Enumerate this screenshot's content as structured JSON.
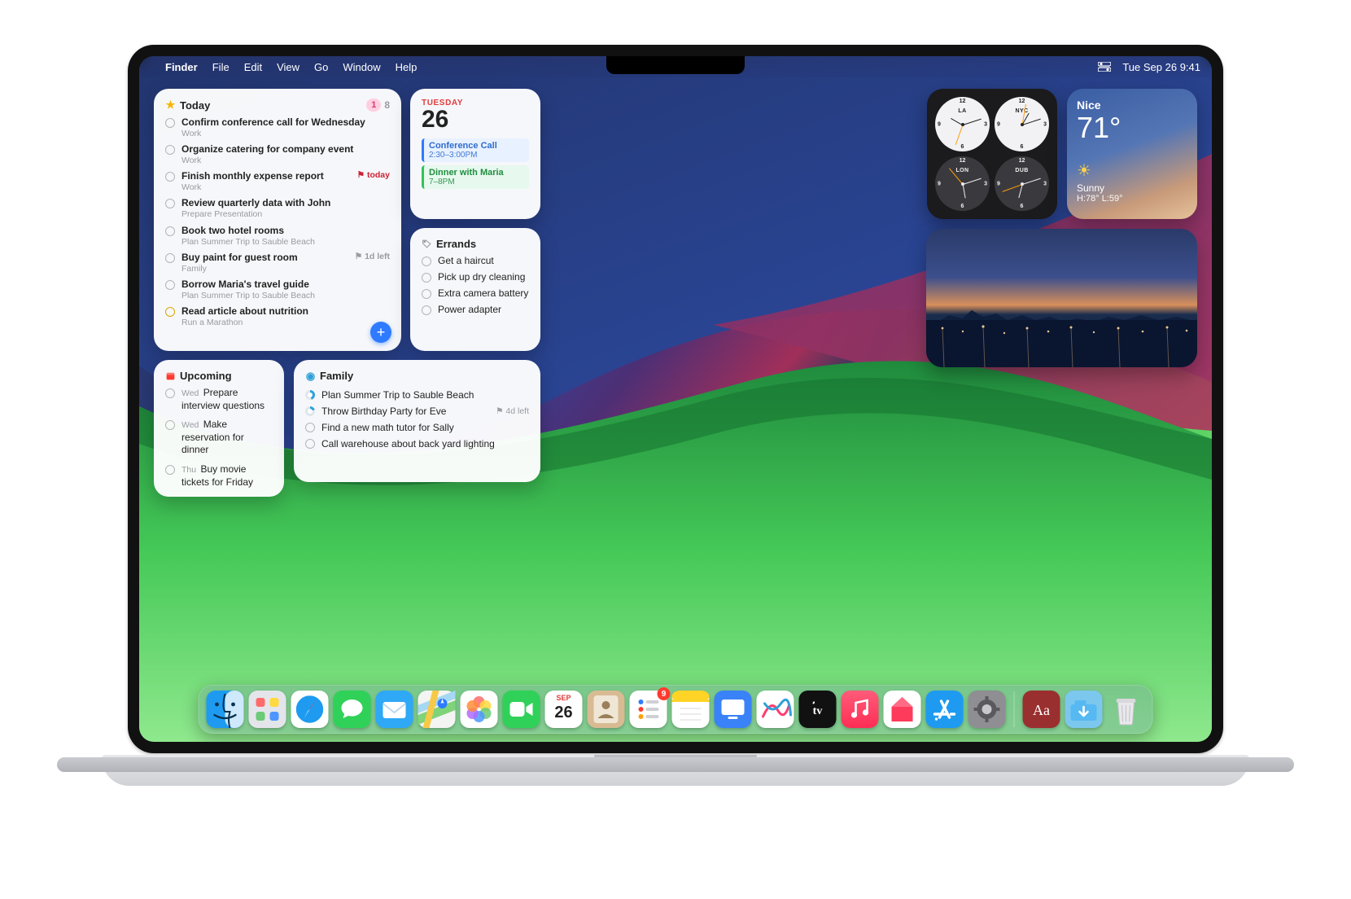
{
  "menubar": {
    "app": "Finder",
    "items": [
      "File",
      "Edit",
      "View",
      "Go",
      "Window",
      "Help"
    ],
    "datetime": "Tue Sep 26  9:41",
    "cc_icon": "control-center-icon"
  },
  "reminders_today": {
    "title": "Today",
    "badge_primary": "1",
    "badge_secondary": "8",
    "items": [
      {
        "title": "Confirm conference call for Wednesday",
        "sub": "Work",
        "meta": ""
      },
      {
        "title": "Organize catering for company event",
        "sub": "Work",
        "meta": ""
      },
      {
        "title": "Finish monthly expense report",
        "sub": "Work",
        "meta": "⚑ today",
        "meta_style": "red"
      },
      {
        "title": "Review quarterly data with John",
        "sub": "Prepare Presentation",
        "meta": ""
      },
      {
        "title": "Book two hotel rooms",
        "sub": "Plan Summer Trip to Sauble Beach",
        "meta": ""
      },
      {
        "title": "Buy paint for guest room",
        "sub": "Family",
        "meta": "⚑ 1d left",
        "meta_style": "gray"
      },
      {
        "title": "Borrow Maria's travel guide",
        "sub": "Plan Summer Trip to Sauble Beach",
        "meta": ""
      },
      {
        "title": "Read article about nutrition",
        "sub": "Run a Marathon",
        "meta": "",
        "icon": "moon"
      }
    ]
  },
  "calendar": {
    "day_label": "TUESDAY",
    "day_num": "26",
    "events": [
      {
        "title": "Conference Call",
        "time": "2:30–3:00PM",
        "color": "blue"
      },
      {
        "title": "Dinner with Maria",
        "time": "7–8PM",
        "color": "green"
      }
    ]
  },
  "errands": {
    "title": "Errands",
    "items": [
      "Get a haircut",
      "Pick up dry cleaning",
      "Extra camera battery",
      "Power adapter"
    ]
  },
  "upcoming": {
    "title": "Upcoming",
    "items": [
      {
        "day": "Wed",
        "title": "Prepare interview questions"
      },
      {
        "day": "Wed",
        "title": "Make reservation for dinner"
      },
      {
        "day": "Thu",
        "title": "Buy movie tickets for Friday"
      }
    ]
  },
  "family": {
    "title": "Family",
    "items": [
      {
        "title": "Plan Summer Trip to Sauble Beach",
        "progress": "p1",
        "meta": ""
      },
      {
        "title": "Throw Birthday Party for Eve",
        "progress": "p2",
        "meta": "⚑ 4d left"
      },
      {
        "title": "Find a new math tutor for Sally",
        "progress": "",
        "meta": ""
      },
      {
        "title": "Call warehouse about back yard lighting",
        "progress": "",
        "meta": ""
      }
    ]
  },
  "clocks": [
    {
      "city": "LA",
      "theme": "light",
      "hr": 300,
      "mn": 72,
      "sc": 200
    },
    {
      "city": "NYC",
      "theme": "light",
      "hr": 30,
      "mn": 72,
      "sc": 10
    },
    {
      "city": "LON",
      "theme": "dark",
      "hr": 170,
      "mn": 72,
      "sc": 320
    },
    {
      "city": "DUB",
      "theme": "dark",
      "hr": 195,
      "mn": 72,
      "sc": 250
    }
  ],
  "weather": {
    "location": "Nice",
    "temp": "71°",
    "condition": "Sunny",
    "high_low": "H:78° L:59°"
  },
  "dock": {
    "items": [
      {
        "name": "finder",
        "badge": ""
      },
      {
        "name": "launchpad",
        "badge": ""
      },
      {
        "name": "safari",
        "badge": ""
      },
      {
        "name": "messages",
        "badge": ""
      },
      {
        "name": "mail",
        "badge": ""
      },
      {
        "name": "maps",
        "badge": ""
      },
      {
        "name": "photos",
        "badge": ""
      },
      {
        "name": "facetime",
        "badge": ""
      },
      {
        "name": "calendar",
        "badge": "",
        "day_label": "SEP",
        "day_num": "26"
      },
      {
        "name": "contacts",
        "badge": ""
      },
      {
        "name": "reminders",
        "badge": "9"
      },
      {
        "name": "notes",
        "badge": ""
      },
      {
        "name": "tv",
        "badge": ""
      },
      {
        "name": "freeform",
        "badge": ""
      },
      {
        "name": "appletv",
        "badge": ""
      },
      {
        "name": "music",
        "badge": ""
      },
      {
        "name": "news",
        "badge": ""
      },
      {
        "name": "appstore",
        "badge": ""
      },
      {
        "name": "settings",
        "badge": ""
      }
    ],
    "right_items": [
      {
        "name": "dictionary"
      },
      {
        "name": "downloads"
      },
      {
        "name": "trash"
      }
    ]
  }
}
